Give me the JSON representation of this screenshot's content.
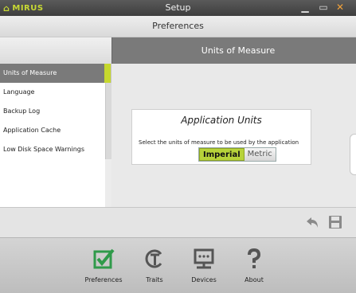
{
  "window": {
    "brand": "MIRUS",
    "title": "Setup",
    "icons": {
      "home": "home-icon",
      "minimize": "minimize-icon",
      "maximize": "maximize-icon",
      "close": "close-icon"
    }
  },
  "header": {
    "title": "Preferences"
  },
  "section": {
    "title": "Units of Measure"
  },
  "sidebar": {
    "items": [
      {
        "label": "Units of Measure",
        "active": true
      },
      {
        "label": "Language"
      },
      {
        "label": "Backup Log"
      },
      {
        "label": "Application Cache"
      },
      {
        "label": "Low Disk Space Warnings"
      }
    ]
  },
  "panel": {
    "title": "Application Units",
    "description": "Select the units of measure to be used by the application",
    "options": [
      {
        "label": "Imperial",
        "selected": true
      },
      {
        "label": "Metric",
        "selected": false
      }
    ]
  },
  "actions": {
    "undo_icon": "undo-icon",
    "save_icon": "save-icon"
  },
  "nav": {
    "items": [
      {
        "label": "Preferences",
        "icon": "checkbox-icon"
      },
      {
        "label": "Traits",
        "icon": "traits-icon"
      },
      {
        "label": "Devices",
        "icon": "device-icon"
      },
      {
        "label": "About",
        "icon": "question-icon"
      }
    ]
  },
  "colors": {
    "accent": "#c6d82e",
    "selected_button": "#b7d33a",
    "section_bar": "#7a7a7a",
    "close": "#f2a23a"
  }
}
